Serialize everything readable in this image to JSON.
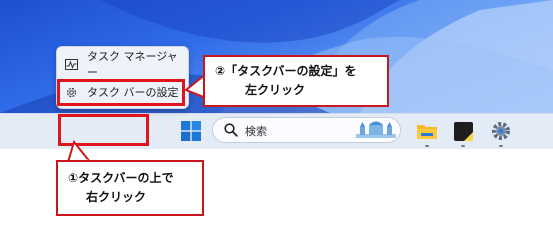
{
  "context_menu": {
    "items": [
      {
        "label": "タスク マネージャー",
        "icon": "task-manager-icon"
      },
      {
        "label": "タスク バーの設定",
        "icon": "gear-icon"
      }
    ]
  },
  "taskbar": {
    "search_placeholder": "検索"
  },
  "callouts": {
    "step2_line1": "②「タスクバーの設定」を",
    "step2_line2": "左クリック",
    "step1_line1": "①タスクバーの上で",
    "step1_line2": "右クリック"
  },
  "colors": {
    "highlight": "#e0141c",
    "taskbar": "#e3ebf6"
  }
}
